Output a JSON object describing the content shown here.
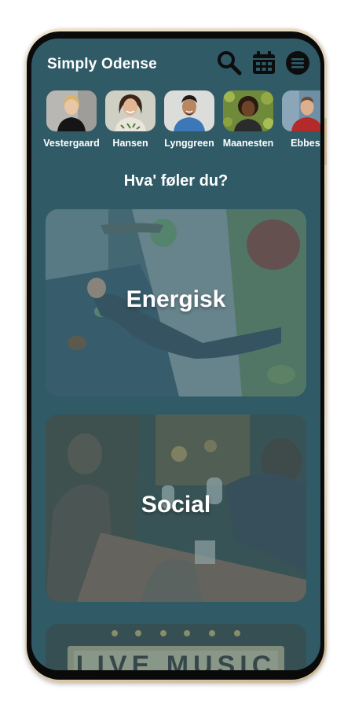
{
  "app": {
    "title": "Simply Odense"
  },
  "header": {
    "icons": [
      "search-icon",
      "calendar-icon",
      "menu-icon"
    ]
  },
  "stories": [
    {
      "name": "Vestergaard"
    },
    {
      "name": "Hansen"
    },
    {
      "name": "Lynggreen"
    },
    {
      "name": "Maanesten"
    },
    {
      "name": "Ebbest"
    }
  ],
  "mood": {
    "question": "Hva' føler du?",
    "cards": [
      {
        "label": "Energisk"
      },
      {
        "label": "Social"
      },
      {
        "label": ""
      }
    ]
  },
  "colors": {
    "background": "#2f5a66",
    "text": "#ffffff",
    "frame": "#d9c7a9"
  }
}
